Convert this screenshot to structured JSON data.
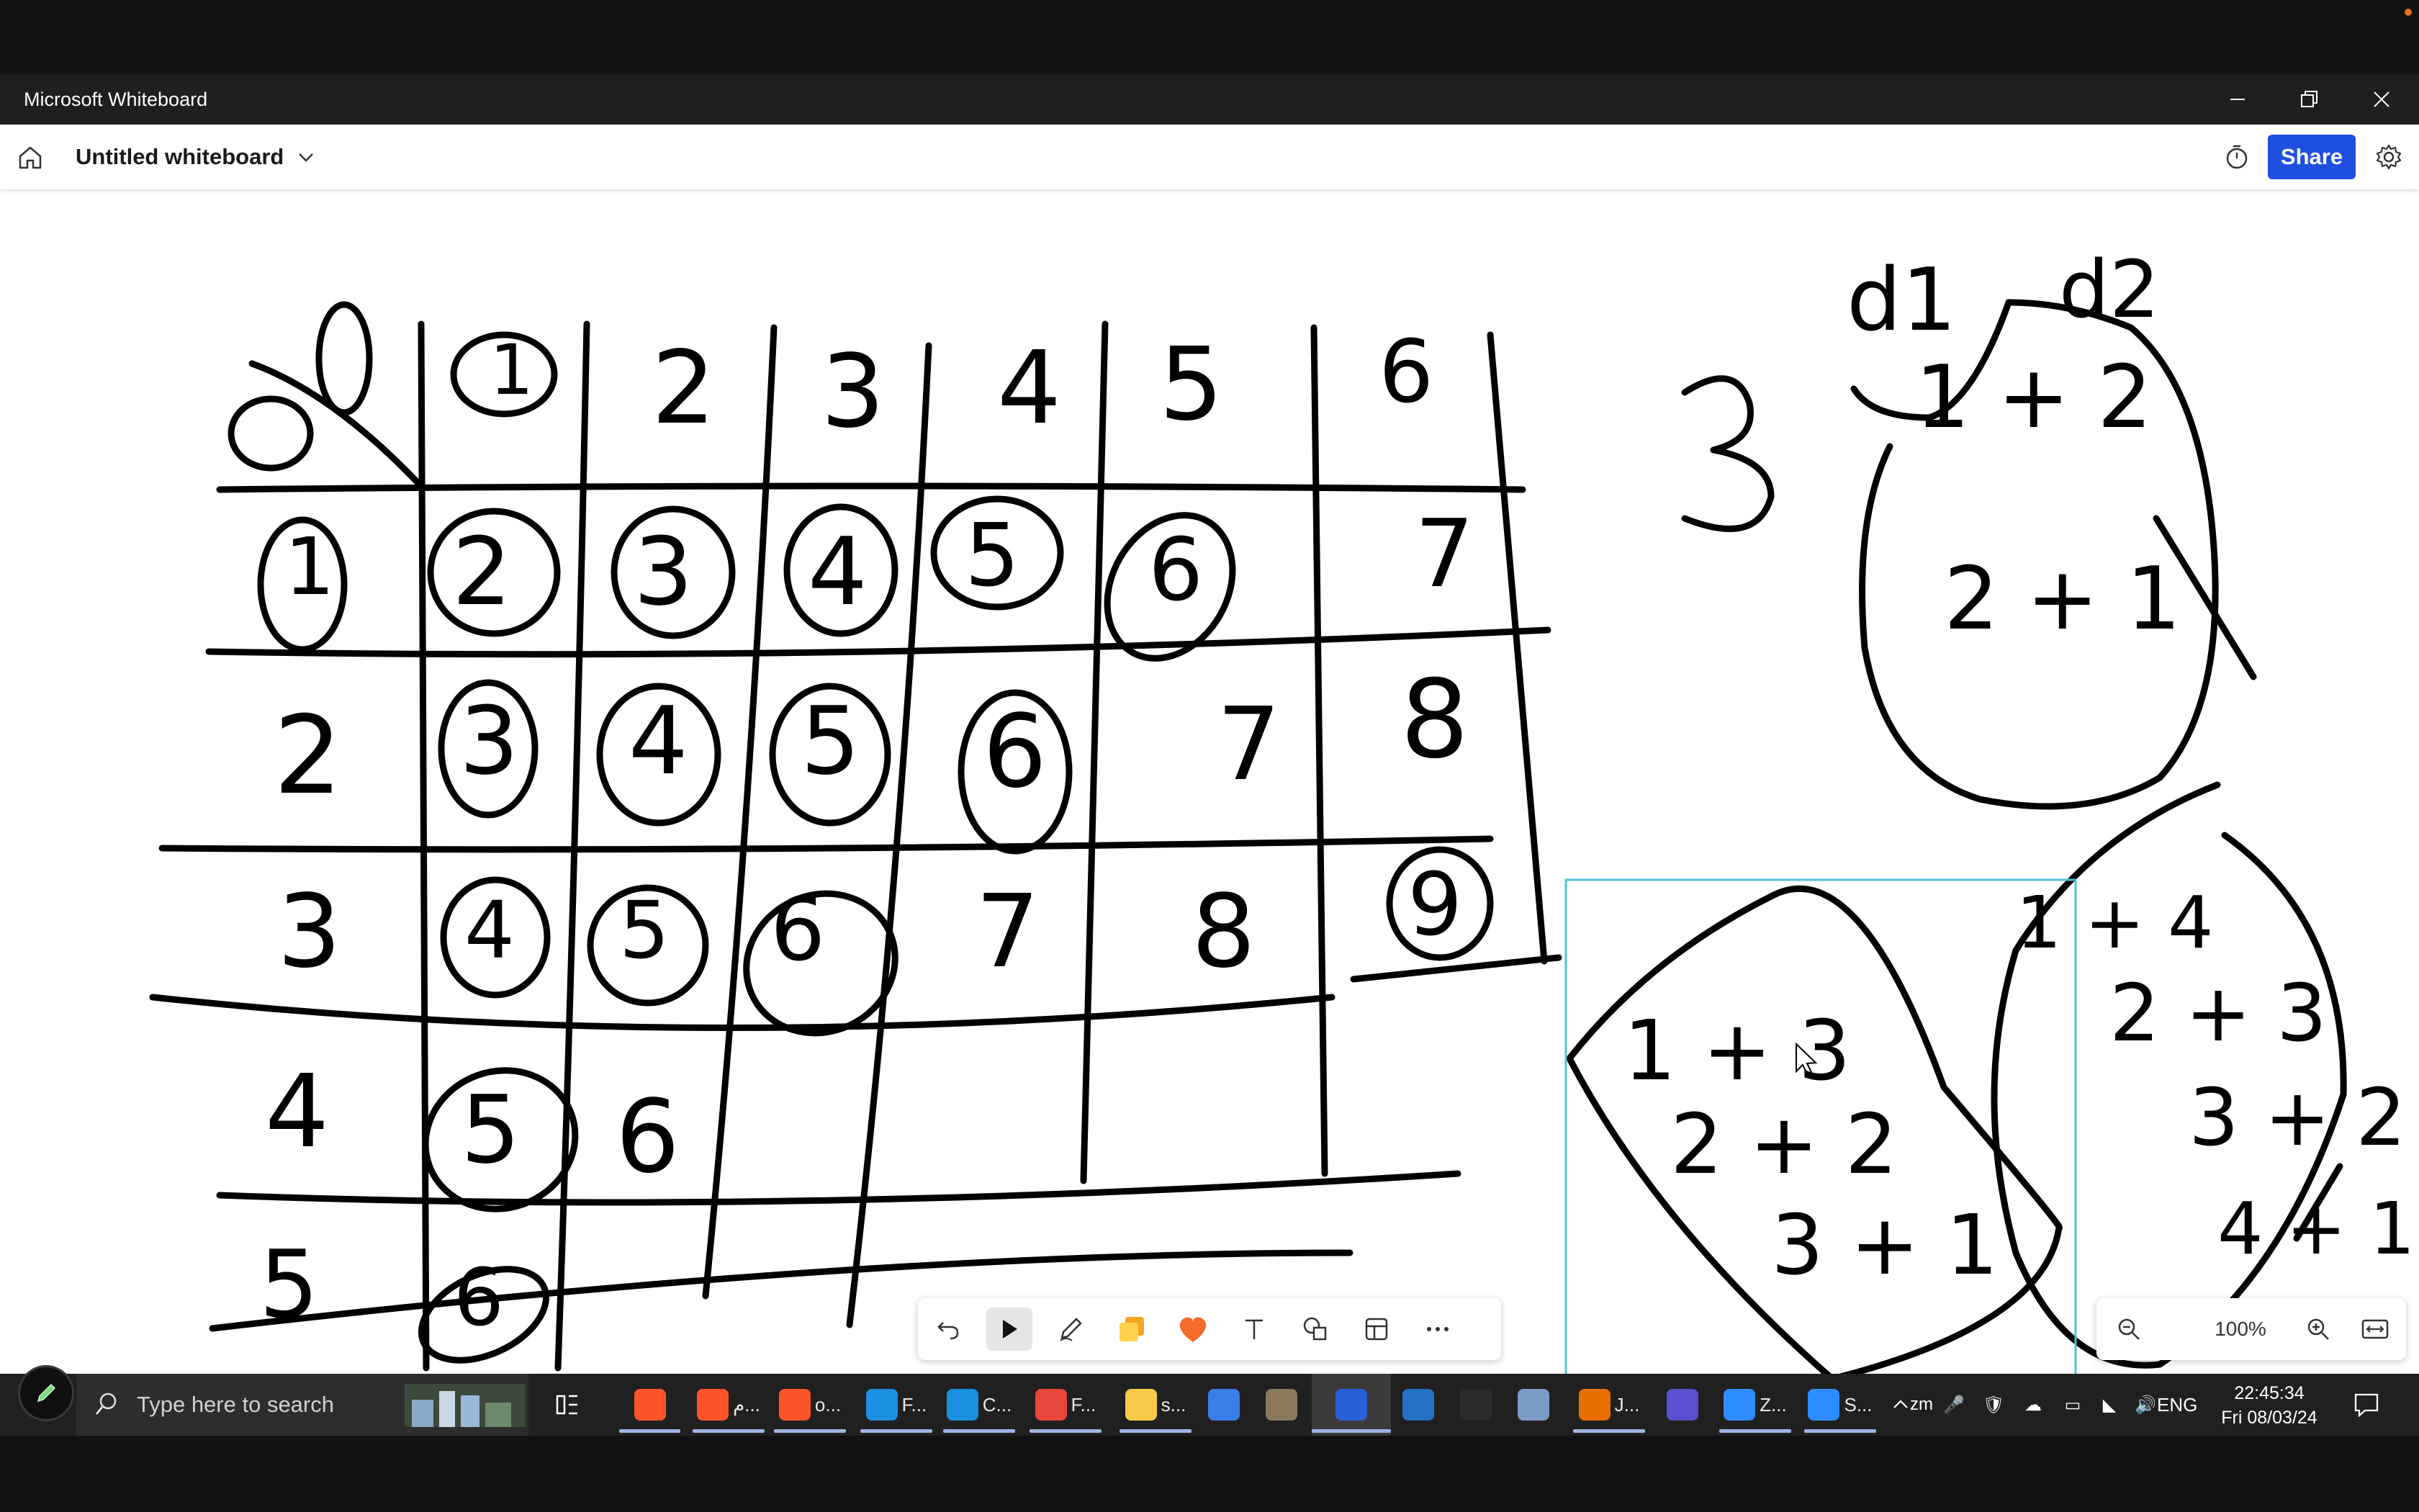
{
  "window": {
    "title": "Microsoft Whiteboard"
  },
  "appbar": {
    "board_title": "Untitled whiteboard",
    "share_label": "Share"
  },
  "toolbar": {
    "tools": [
      "undo",
      "select",
      "pen",
      "sticky-note",
      "reactions",
      "text",
      "shapes",
      "templates",
      "more"
    ]
  },
  "zoom": {
    "value": "100%"
  },
  "whiteboard": {
    "header_numbers": [
      "1",
      "2",
      "3",
      "4",
      "5",
      "6"
    ],
    "row_labels": [
      "1",
      "2",
      "3",
      "4",
      "5"
    ],
    "grid_rows": [
      [
        "2",
        "3",
        "4",
        "5",
        "6",
        "7"
      ],
      [
        "3",
        "4",
        "5",
        "6",
        "7",
        "8"
      ],
      [
        "4",
        "5",
        "6",
        "7",
        "8",
        "9"
      ],
      [
        "5",
        "6"
      ],
      [
        "6"
      ]
    ],
    "side_number": "3",
    "d_labels": [
      "d1",
      "d2"
    ],
    "bag1_lines": [
      "1 + 2",
      "2 + 1"
    ],
    "bag2_lines": [
      "1 + 3",
      "2 + 2",
      "3 + 1"
    ],
    "bag3_lines": [
      "1 + 4",
      "2 + 3",
      "3 + 2",
      "4 + 1"
    ]
  },
  "taskbar": {
    "search_placeholder": "Type here to search",
    "apps": [
      {
        "icon": "brave-icon",
        "label": "",
        "color": "#fb542b"
      },
      {
        "icon": "brave-icon",
        "label": "م...",
        "color": "#fb542b"
      },
      {
        "icon": "brave-icon",
        "label": "o...",
        "color": "#fb542b"
      },
      {
        "icon": "edge-icon",
        "label": "F...",
        "color": "#1b8fe0"
      },
      {
        "icon": "edge-icon",
        "label": "C...",
        "color": "#1b8fe0"
      },
      {
        "icon": "chrome-icon",
        "label": "F...",
        "color": "#e8453c"
      },
      {
        "icon": "folder-icon",
        "label": "s...",
        "color": "#f7c948"
      },
      {
        "icon": "word-doc-icon",
        "label": "",
        "color": "#3a7ee8"
      },
      {
        "icon": "gimp-icon",
        "label": "",
        "color": "#8a7a5a"
      },
      {
        "icon": "whiteboard-icon",
        "label": "",
        "color": "#2a5fd6"
      },
      {
        "icon": "powershell-icon",
        "label": "",
        "color": "#2670c6"
      },
      {
        "icon": "terminal-icon",
        "label": "",
        "color": "#2b2b2b"
      },
      {
        "icon": "document-icon",
        "label": "",
        "color": "#7a9cc6"
      },
      {
        "icon": "java-icon",
        "label": "J...",
        "color": "#e76f00"
      },
      {
        "icon": "obs-icon",
        "label": "",
        "color": "#5a4fcf"
      },
      {
        "icon": "zoom-icon",
        "label": "Z...",
        "color": "#2d8cff"
      },
      {
        "icon": "zoom-icon",
        "label": "S...",
        "color": "#2d8cff"
      }
    ],
    "tray_icons": [
      "zoom-tray-icon",
      "microphone-icon",
      "security-icon",
      "cloud-icon",
      "battery-icon",
      "wifi-icon",
      "volume-icon"
    ],
    "language": "ENG",
    "time": "22:45:34",
    "date": "Fri 08/03/24"
  }
}
